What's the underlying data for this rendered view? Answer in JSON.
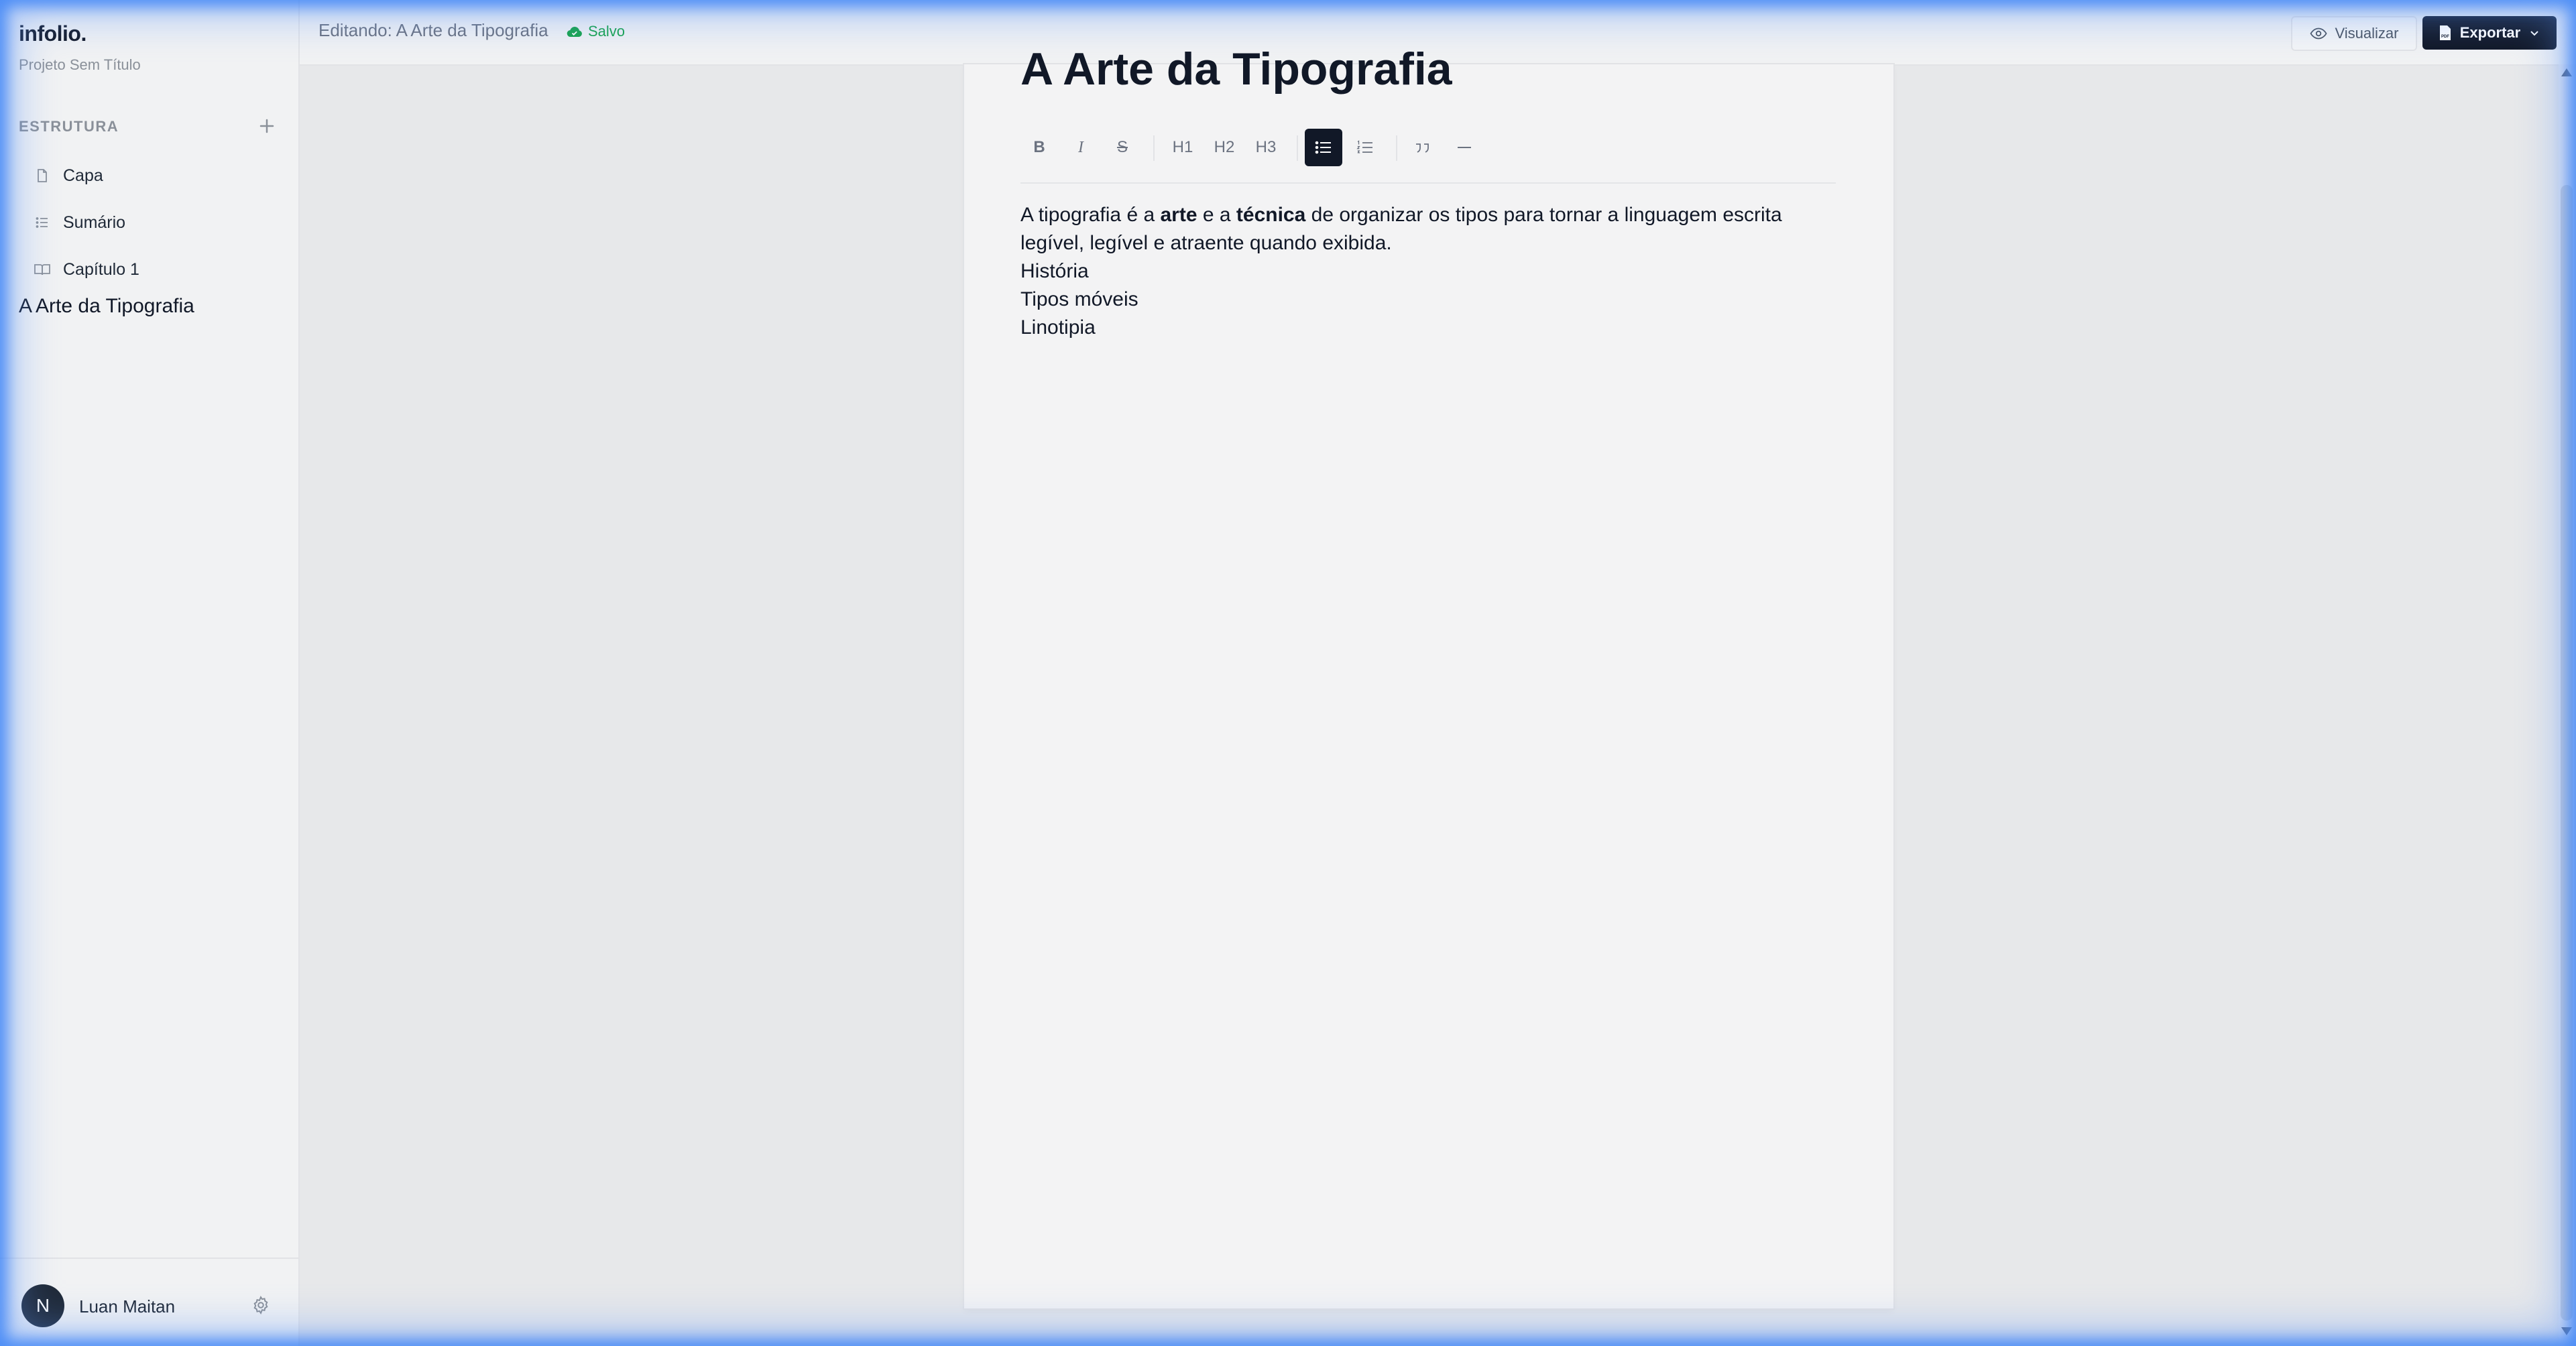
{
  "app": {
    "logo": "infolio",
    "logo_dot": ".",
    "project_name": "Projeto Sem Título"
  },
  "sidebar": {
    "section_title": "ESTRUTURA",
    "items": [
      {
        "label": "Capa",
        "icon": "file-icon"
      },
      {
        "label": "Sumário",
        "icon": "list-icon"
      },
      {
        "label": "Capítulo 1",
        "icon": "book-icon"
      }
    ],
    "current_doc": "A Arte da Tipografia"
  },
  "user": {
    "initial": "N",
    "name": "Luan Maitan"
  },
  "topbar": {
    "editing": "Editando: A Arte da Tipografia",
    "saved": "Salvo",
    "preview_label": "Visualizar",
    "export_label": "Exportar"
  },
  "editor": {
    "title": "A Arte da Tipografia",
    "toolbar": {
      "bold": "B",
      "italic": "I",
      "strike": "S",
      "h1": "H1",
      "h2": "H2",
      "h3": "H3",
      "active": "bullet-list"
    },
    "paragraph": {
      "p1": "A tipografia é a ",
      "b1": "arte",
      "p2": " e a ",
      "b2": "técnica",
      "p3": " de organizar os tipos para tornar a linguagem escrita legível, legível e atraente quando exibida."
    },
    "lines": [
      "História",
      "Tipos móveis",
      "Linotipia"
    ]
  },
  "colors": {
    "accent": "#111827",
    "saved": "#16a34a",
    "border_glow": "#3b82f6"
  }
}
